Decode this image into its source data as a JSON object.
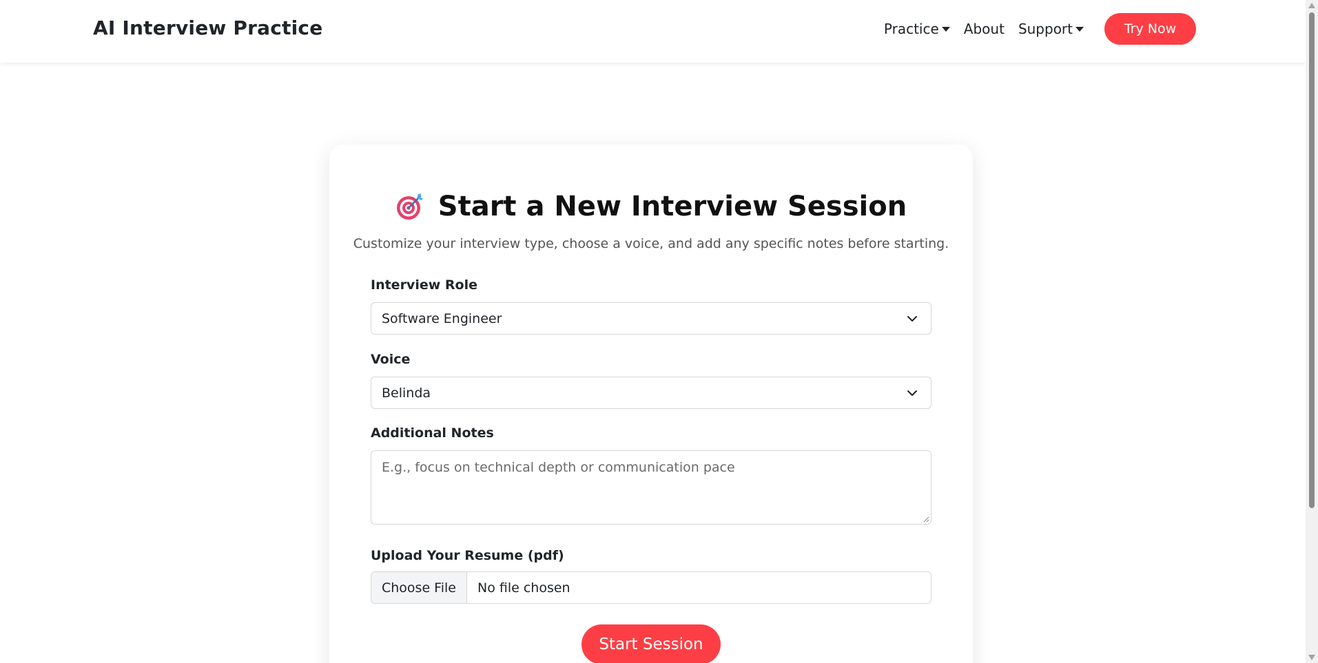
{
  "navbar": {
    "brand": "AI Interview Practice",
    "links": [
      {
        "label": "Practice",
        "dropdown": true
      },
      {
        "label": "About",
        "dropdown": false
      },
      {
        "label": "Support",
        "dropdown": true
      }
    ],
    "cta_label": "Try Now"
  },
  "card": {
    "icon": "target-dart-icon",
    "title": "Start a New Interview Session",
    "subtitle": "Customize your interview type, choose a voice, and add any specific notes before starting.",
    "role": {
      "label": "Interview Role",
      "value": "Software Engineer"
    },
    "voice": {
      "label": "Voice",
      "value": "Belinda"
    },
    "notes": {
      "label": "Additional Notes",
      "placeholder": "E.g., focus on technical depth or communication pace"
    },
    "resume": {
      "label": "Upload Your Resume (pdf)",
      "button_label": "Choose File",
      "status": "No file chosen"
    },
    "submit_label": "Start Session"
  },
  "colors": {
    "accent": "#fd3f45",
    "text": "#212529",
    "muted": "#555555",
    "border": "#d7d7d7"
  }
}
